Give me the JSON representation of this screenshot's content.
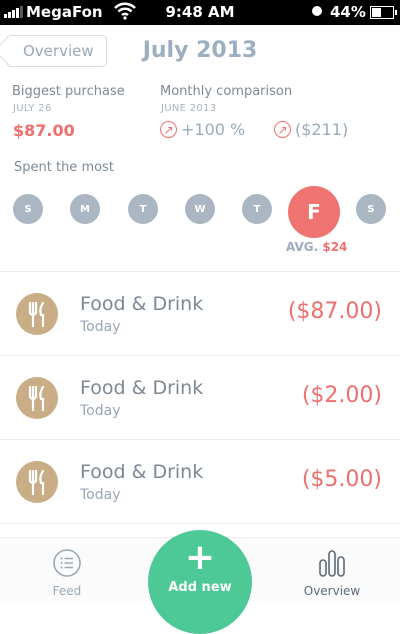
{
  "status_bar": {
    "carrier": "MegaFon",
    "time": "9:48 AM",
    "battery": "44%",
    "battery_level": 0.44,
    "icons": [
      "signal-icon",
      "wifi-icon",
      "clock-icon",
      "battery-icon"
    ]
  },
  "nav": {
    "back_label": "Overview",
    "title": "July 2013"
  },
  "summary": {
    "biggest_purchase": {
      "label": "Biggest purchase",
      "date": "JULY 26",
      "value": "$87.00"
    },
    "monthly_comparison": {
      "label": "Monthly comparison",
      "date": "JUNE 2013",
      "items": [
        "+100 %",
        "($211)"
      ]
    },
    "spent_most_label": "Spent the most"
  },
  "week": {
    "days": [
      "S",
      "M",
      "T",
      "W",
      "T",
      "F",
      "S"
    ],
    "active_day": "F",
    "avg_label": "AVG.",
    "avg_value": "$24"
  },
  "transactions": [
    {
      "category": "Food & Drink",
      "date": "Today",
      "amount": "($87.00)",
      "icon": "fork-knife-icon"
    },
    {
      "category": "Food & Drink",
      "date": "Today",
      "amount": "($2.00)",
      "icon": "fork-knife-icon"
    },
    {
      "category": "Food & Drink",
      "date": "Today",
      "amount": "($5.00)",
      "icon": "fork-knife-icon"
    }
  ],
  "tabbar": {
    "feed": "Feed",
    "add_new": "Add new",
    "overview": "Overview",
    "icons": [
      "list-icon",
      "plus-icon",
      "bar-chart-icon"
    ]
  },
  "colors": {
    "accent_red": "#ef6f6c",
    "accent_green": "#4cc996",
    "muted_blue": "#9cafc1",
    "category_tan": "#c9ad86",
    "day_grey": "#aab6c2"
  }
}
